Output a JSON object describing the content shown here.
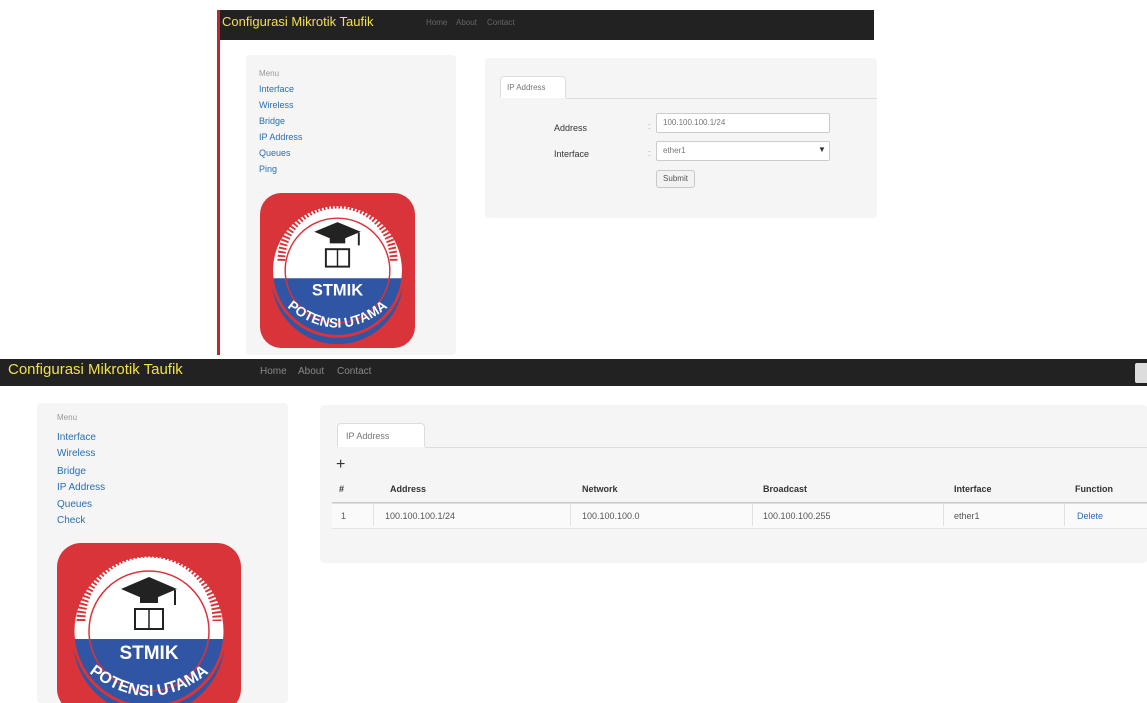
{
  "top": {
    "brand": "Configurasi Mikrotik Taufik",
    "nav": [
      "Home",
      "About",
      "Contact"
    ],
    "sidebar": {
      "heading": "Menu",
      "items": [
        "Interface",
        "Wireless",
        "Bridge",
        "IP Address",
        "Queues",
        "Ping"
      ]
    },
    "tab": "IP Address",
    "form": {
      "address_label": "Address",
      "address_value": "100.100.100.1/24",
      "interface_label": "Interface",
      "interface_value": "ether1",
      "submit_label": "Submit"
    }
  },
  "bottom": {
    "brand": "Configurasi Mikrotik Taufik",
    "nav": [
      "Home",
      "About",
      "Contact"
    ],
    "sidebar": {
      "heading": "Menu",
      "items": [
        "Interface",
        "Wireless",
        "Bridge",
        "IP Address",
        "Queues",
        "Check"
      ]
    },
    "tab": "IP Address",
    "add_symbol": "+",
    "table": {
      "headers": [
        "#",
        "Address",
        "Network",
        "Broadcast",
        "Interface",
        "Function"
      ],
      "rows": [
        [
          "1",
          "100.100.100.1/24",
          "100.100.100.0",
          "100.100.100.255",
          "ether1",
          "Delete"
        ]
      ]
    }
  },
  "logo": {
    "arc_text": "SEKOLAH TINGGI MANAJEMEN INFORMATIKA DAN KOMPUTER",
    "name": "STMIK",
    "motto": "POTENSI UTAMA",
    "colors": {
      "red": "#d9343a",
      "blue": "#2f55a4",
      "white": "#ffffff"
    }
  }
}
